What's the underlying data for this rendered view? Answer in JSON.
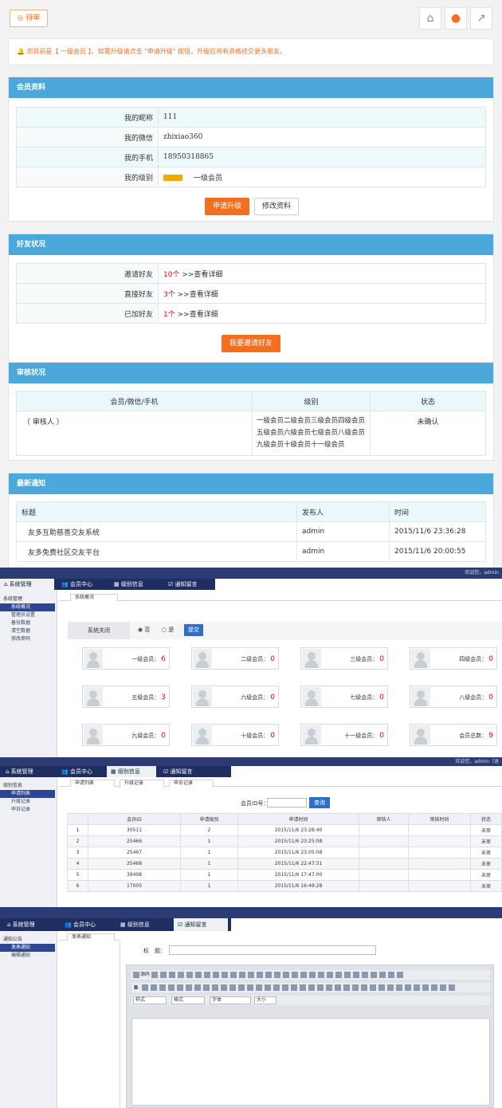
{
  "top": {
    "pending_label": "◎ 待审",
    "notice": "🔔 您目前是【 一级会员 】，如需升级请点击 \"申请升级\" 按钮，升级后将有资格结交更多朋友。",
    "member": {
      "title": "会员资料",
      "rows": [
        {
          "k": "我的昵称",
          "v": "111"
        },
        {
          "k": "我的微信",
          "v": "zhixiao360"
        },
        {
          "k": "我的手机",
          "v": "18950318865"
        },
        {
          "k": "我的级别",
          "v": "一级会员"
        }
      ],
      "apply_btn": "申请升级",
      "edit_btn": "修改资料"
    },
    "friends": {
      "title": "好友状况",
      "rows": [
        {
          "k": "邀请好友",
          "n": "10个",
          "link": ">>查看详细"
        },
        {
          "k": "直接好友",
          "n": "3个",
          "link": ">>查看详细"
        },
        {
          "k": "已加好友",
          "n": "1个",
          "link": ">>查看详细"
        }
      ],
      "invite_btn": "我要邀请好友"
    },
    "audit": {
      "title": "审核状况",
      "cols": [
        "会员/微信/手机",
        "级别",
        "状态"
      ],
      "row": {
        "member": "（ 审核人 ）",
        "level": "一级会员二级会员三级会员四级会员五级会员六级会员七级会员八级会员九级会员十级会员十一级会员",
        "status": "未确认"
      }
    },
    "news": {
      "title": "最新通知",
      "cols": [
        "标题",
        "发布人",
        "时间"
      ],
      "rows": [
        {
          "t": "友多互助慈善交友系统",
          "a": "admin",
          "d": "2015/11/6 23:36:28"
        },
        {
          "t": "友多免费社区交友平台",
          "a": "admin",
          "d": "2015/11/6 20:00:55"
        }
      ]
    }
  },
  "admin1": {
    "welcome": "欢迎您，admin",
    "tabs": [
      "系统管理",
      "会员中心",
      "级别信息",
      "通知留言"
    ],
    "side": {
      "head": "系统管理",
      "items": [
        "系统概况",
        "管理员设置",
        "备份数据",
        "清空数据",
        "修改密码"
      ]
    },
    "subtab": "系统概况",
    "close_label": "系统关闭",
    "opt_no": "否",
    "opt_yes": "是",
    "submit": "提交",
    "cards": [
      {
        "l": "一级会员：",
        "n": "6"
      },
      {
        "l": "二级会员：",
        "n": "0"
      },
      {
        "l": "三级会员：",
        "n": "0"
      },
      {
        "l": "四级会员：",
        "n": "0"
      },
      {
        "l": "五级会员：",
        "n": "3"
      },
      {
        "l": "六级会员：",
        "n": "0"
      },
      {
        "l": "七级会员：",
        "n": "0"
      },
      {
        "l": "八级会员：",
        "n": "0"
      },
      {
        "l": "九级会员：",
        "n": "0"
      },
      {
        "l": "十级会员：",
        "n": "0"
      },
      {
        "l": "十一级会员：",
        "n": "0"
      },
      {
        "l": "会员总数：",
        "n": "9"
      }
    ]
  },
  "admin2": {
    "welcome": "欢迎您，admin（退",
    "tabs": [
      "系统管理",
      "会员中心",
      "级别信息",
      "通知留言"
    ],
    "side": {
      "head": "级别信息",
      "items": [
        "申请列表",
        "升级记录",
        "申诉记录"
      ]
    },
    "subtabs": [
      "申请列表",
      "升级记录",
      "申诉记录"
    ],
    "search_label": "会员ID号：",
    "search_btn": "查询",
    "cols": [
      "",
      "会员ID",
      "申请级别",
      "申请时间",
      "审核人",
      "审核时间",
      "状态"
    ],
    "rows": [
      [
        "1",
        "30511",
        "2",
        "2015/11/6 23:28:40",
        "",
        "",
        "未审"
      ],
      [
        "2",
        "25466",
        "1",
        "2015/11/6 23:25:08",
        "",
        "",
        "未审"
      ],
      [
        "3",
        "25467",
        "1",
        "2015/11/6 23:05:08",
        "",
        "",
        "未审"
      ],
      [
        "4",
        "25468",
        "1",
        "2015/11/6 22:47:31",
        "",
        "",
        "未审"
      ],
      [
        "5",
        "39498",
        "1",
        "2015/11/6 17:47:00",
        "",
        "",
        "未审"
      ],
      [
        "6",
        "17005",
        "1",
        "2015/11/6 16:49:28",
        "",
        "",
        "未审"
      ]
    ]
  },
  "admin3": {
    "tabs": [
      "系统管理",
      "会员中心",
      "级别信息",
      "通知留言"
    ],
    "side": {
      "head": "通知公告",
      "items": [
        "发表通知",
        "编辑通知"
      ]
    },
    "subtab": "发表通知",
    "title_label": "标　题：",
    "editor": {
      "source": "源码",
      "style": "样式",
      "format": "格式",
      "font": "字体",
      "size": "大小"
    }
  }
}
